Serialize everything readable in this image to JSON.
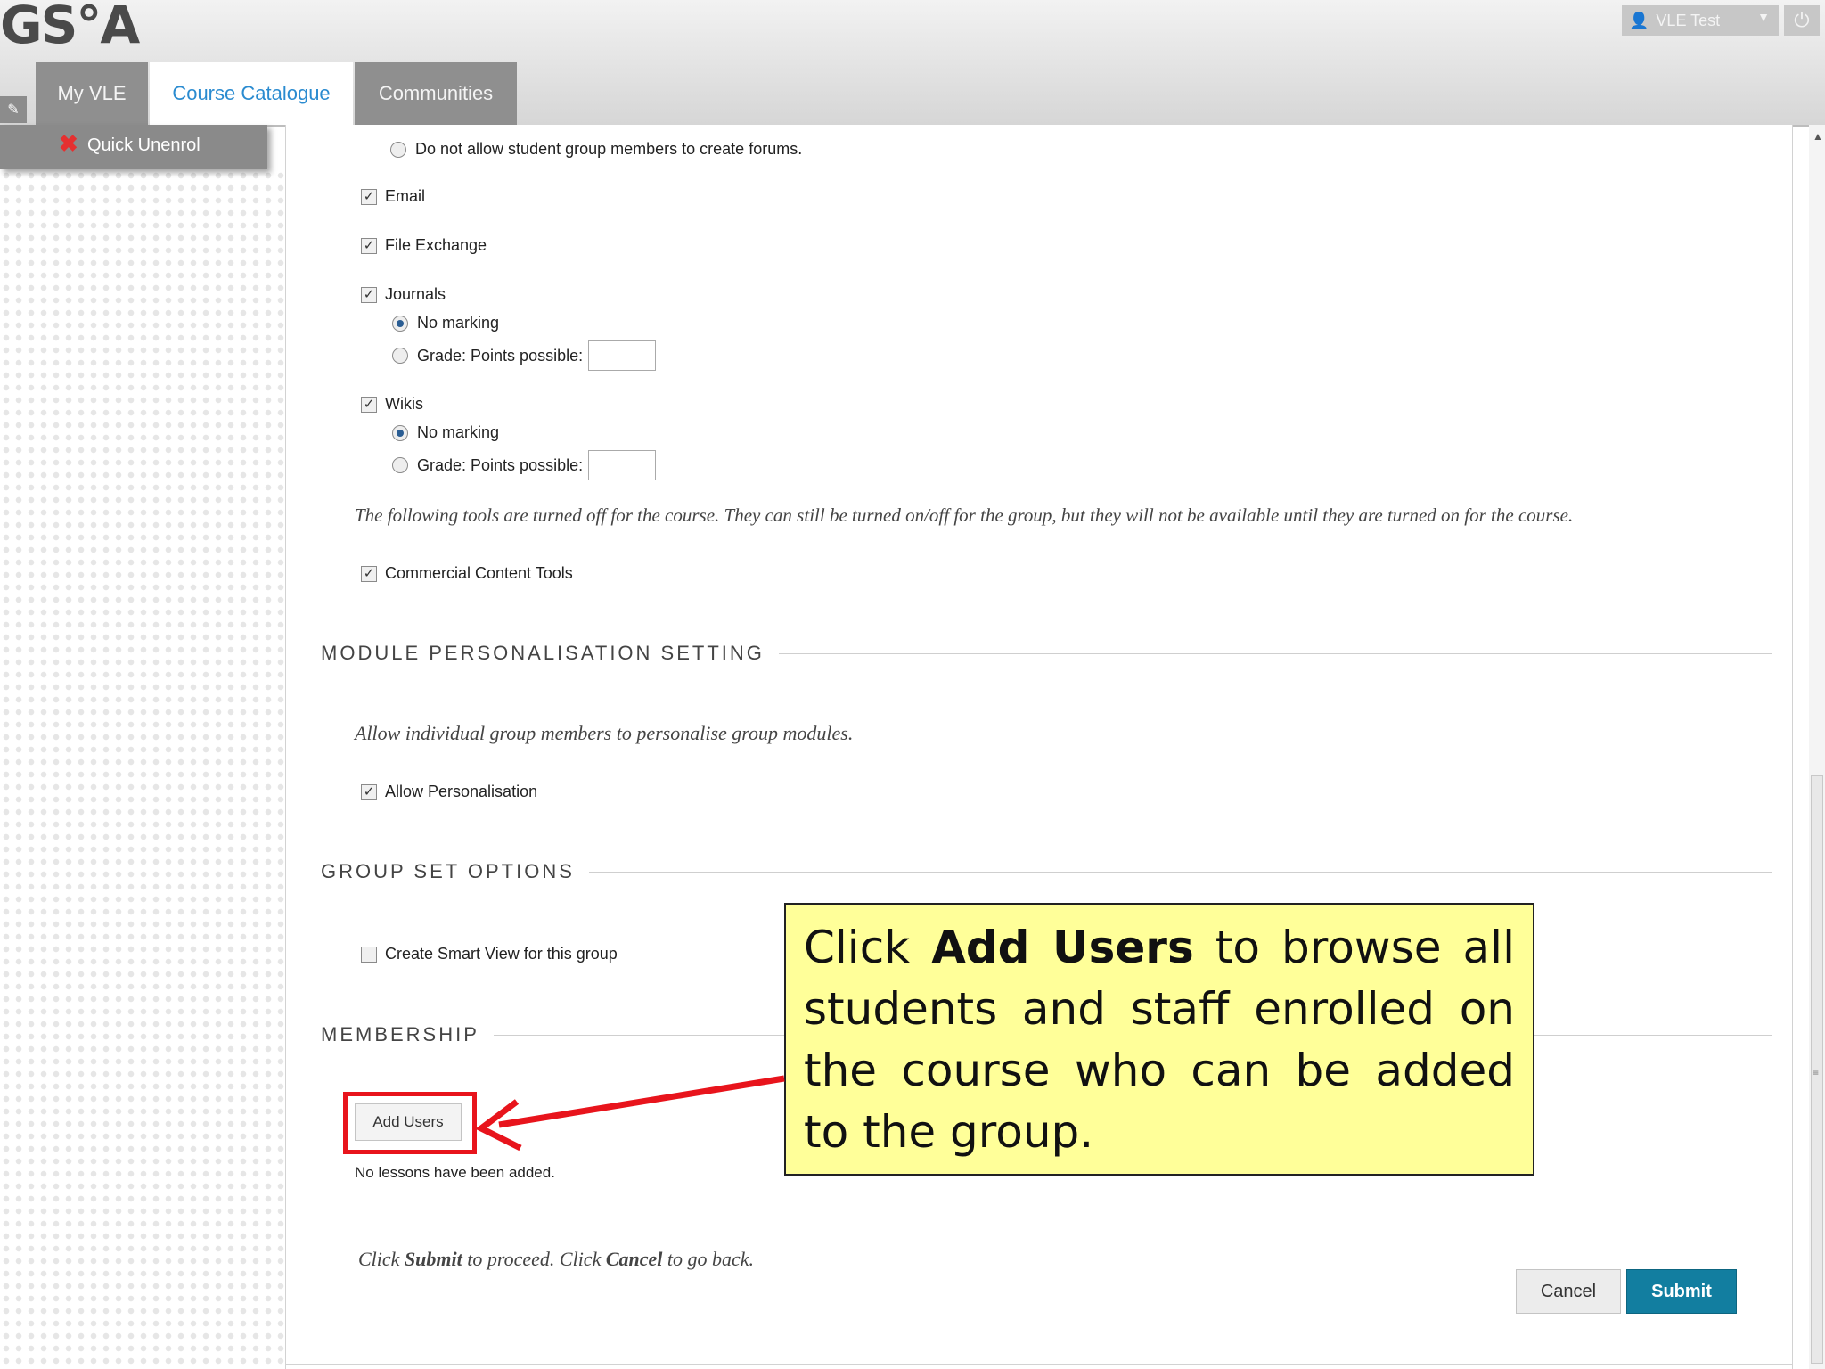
{
  "header": {
    "logo": "GS°A",
    "user_name": "VLE Test",
    "tabs": [
      {
        "label": "My VLE"
      },
      {
        "label": "Course Catalogue"
      },
      {
        "label": "Communities"
      }
    ],
    "quick_unenrol": "Quick Unenrol"
  },
  "form": {
    "forum_option": "Do not allow student group members to create forums.",
    "email": "Email",
    "file_exchange": "File Exchange",
    "journals": "Journals",
    "no_marking": "No marking",
    "grade_points": "Grade: Points possible:",
    "wikis": "Wikis",
    "tools_note": "The following tools are turned off for the course. They can still be turned on/off for the group, but they will not be available until they are turned on for the course.",
    "commercial_tools": "Commercial Content Tools",
    "module_section": "MODULE PERSONALISATION SETTING",
    "module_note": "Allow individual group members to personalise group modules.",
    "allow_personalisation": "Allow Personalisation",
    "group_set_section": "GROUP SET OPTIONS",
    "smart_view": "Create Smart View for this group",
    "membership_section": "MEMBERSHIP",
    "add_users": "Add Users",
    "no_lessons": "No lessons have been added.",
    "submit_note_prefix": "Click ",
    "submit_word": "Submit",
    "submit_note_mid": " to proceed. Click ",
    "cancel_word": "Cancel",
    "submit_note_suffix": " to go back.",
    "cancel_button": "Cancel",
    "submit_button": "Submit"
  },
  "callout": {
    "prefix": "Click ",
    "bold": "Add Users",
    "suffix": " to browse all students and staff enrolled on the course who can be added to the group."
  },
  "colors": {
    "accent_tab": "#2a8bd0",
    "submit": "#127ea0",
    "callout_bg": "#ffff99",
    "highlight": "#e8141c"
  },
  "icons": [
    "user-icon",
    "power-icon",
    "pencil-icon",
    "close-x-icon",
    "arrow-icon"
  ]
}
